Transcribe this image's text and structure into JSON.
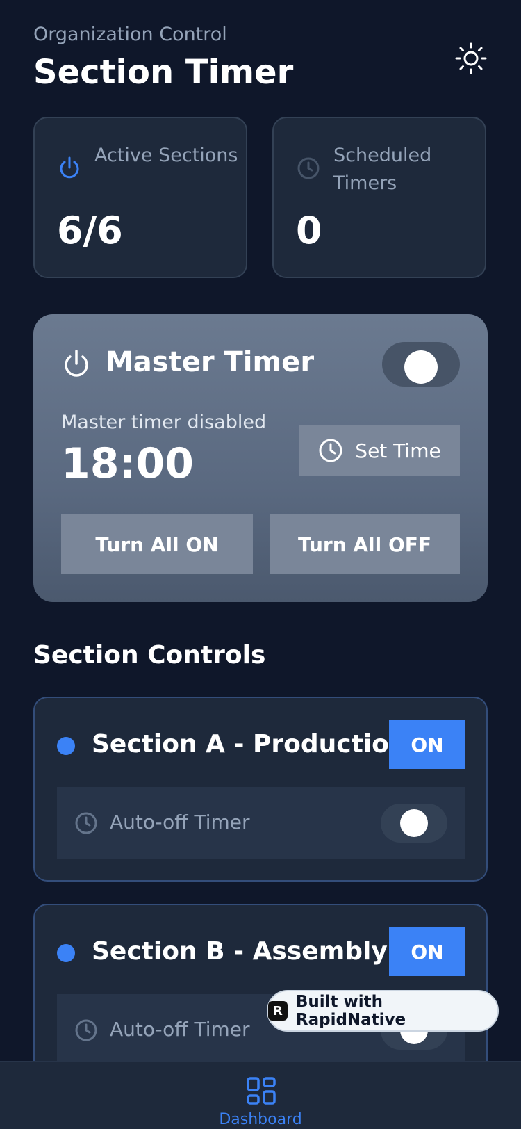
{
  "header": {
    "subtitle": "Organization Control",
    "title": "Section Timer",
    "theme_icon": "sun-icon"
  },
  "stats": [
    {
      "label": "Active Sections",
      "value": "6/6",
      "icon": "power-icon",
      "icon_color": "#3b82f6"
    },
    {
      "label": "Scheduled Timers",
      "value": "0",
      "icon": "clock-icon",
      "icon_color": "#475569"
    }
  ],
  "master": {
    "title": "Master Timer",
    "toggle_on": false,
    "status": "Master timer disabled",
    "time": "18:00",
    "set_time_label": "Set Time",
    "turn_all_on_label": "Turn All ON",
    "turn_all_off_label": "Turn All OFF"
  },
  "section_controls": {
    "heading": "Section Controls",
    "sections": [
      {
        "name": "Section A - Production",
        "state_label": "ON",
        "auto_off_label": "Auto-off Timer",
        "auto_off_enabled": false
      },
      {
        "name": "Section B - Assembly",
        "state_label": "ON",
        "auto_off_label": "Auto-off Timer",
        "auto_off_enabled": false
      }
    ]
  },
  "badge": {
    "label": "Built with RapidNative",
    "logo_letter": "R"
  },
  "nav": {
    "items": [
      {
        "label": "Dashboard",
        "icon": "grid-icon",
        "active": true
      }
    ]
  },
  "colors": {
    "background": "#0f172a",
    "card": "#1e293b",
    "accent": "#3b82f6",
    "muted_text": "#94a3b8"
  }
}
